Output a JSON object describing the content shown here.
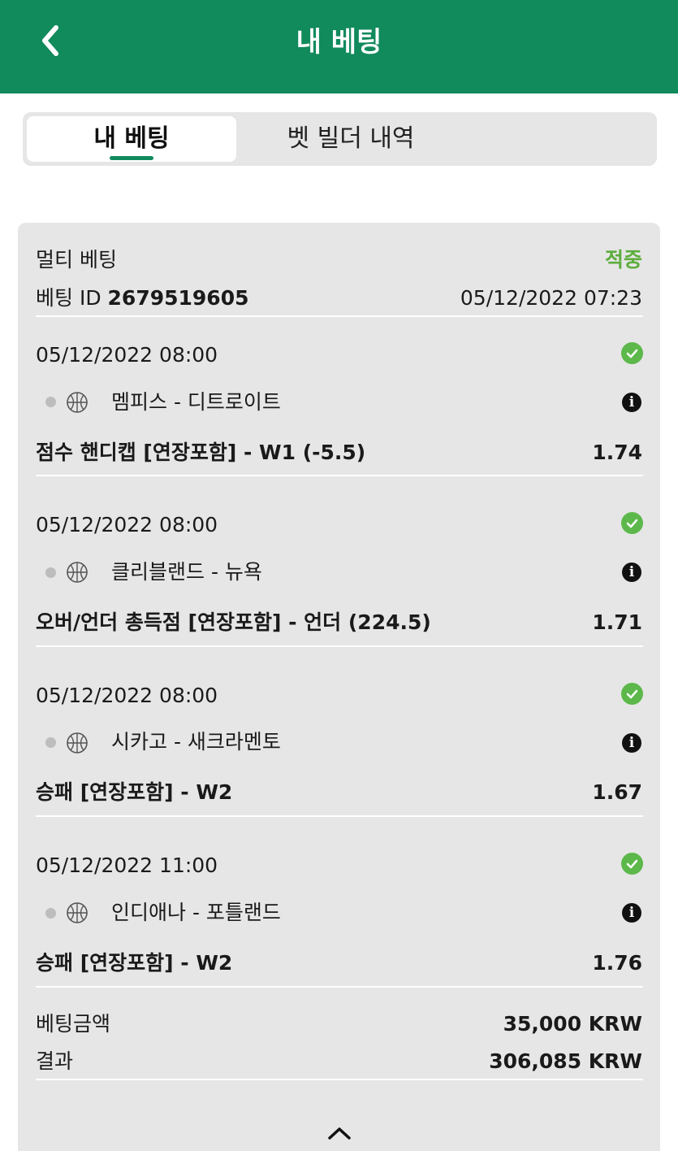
{
  "header": {
    "title": "내 베팅",
    "back_icon": "chevron-left-icon",
    "color": "#118a5c"
  },
  "tabs": [
    {
      "label": "내 베팅",
      "active": true
    },
    {
      "label": "벳 빌더 내역",
      "active": false
    }
  ],
  "bet": {
    "type_label": "멀티 베팅",
    "status": "적중",
    "id_label": "베팅 ID",
    "id_value": "2679519605",
    "placed_at": "05/12/2022 07:23",
    "selections": [
      {
        "datetime": "05/12/2022 08:00",
        "teams": "멤피스 - 디트로이트",
        "market": "점수 핸디캡 [연장포함] - W1 (-5.5)",
        "odds": "1.74"
      },
      {
        "datetime": "05/12/2022 08:00",
        "teams": "클리블랜드 - 뉴욕",
        "market": "오버/언더 총득점 [연장포함] - 언더 (224.5)",
        "odds": "1.71"
      },
      {
        "datetime": "05/12/2022 08:00",
        "teams": "시카고 - 새크라멘토",
        "market": "승패 [연장포함] - W2",
        "odds": "1.67"
      },
      {
        "datetime": "05/12/2022 11:00",
        "teams": "인디애나 - 포틀랜드",
        "market": "승패 [연장포함] - W2",
        "odds": "1.76"
      }
    ],
    "stake_label": "베팅금액",
    "stake_value": "35,000 KRW",
    "result_label": "결과",
    "result_value": "306,085 KRW"
  },
  "colors": {
    "brand": "#118a5c",
    "win": "#5cad3c",
    "card_bg": "#e6e6e6"
  },
  "icons": {
    "won": "check-circle-icon",
    "info": "info-icon",
    "sport": "basketball-icon",
    "collapse": "chevron-up-icon"
  }
}
